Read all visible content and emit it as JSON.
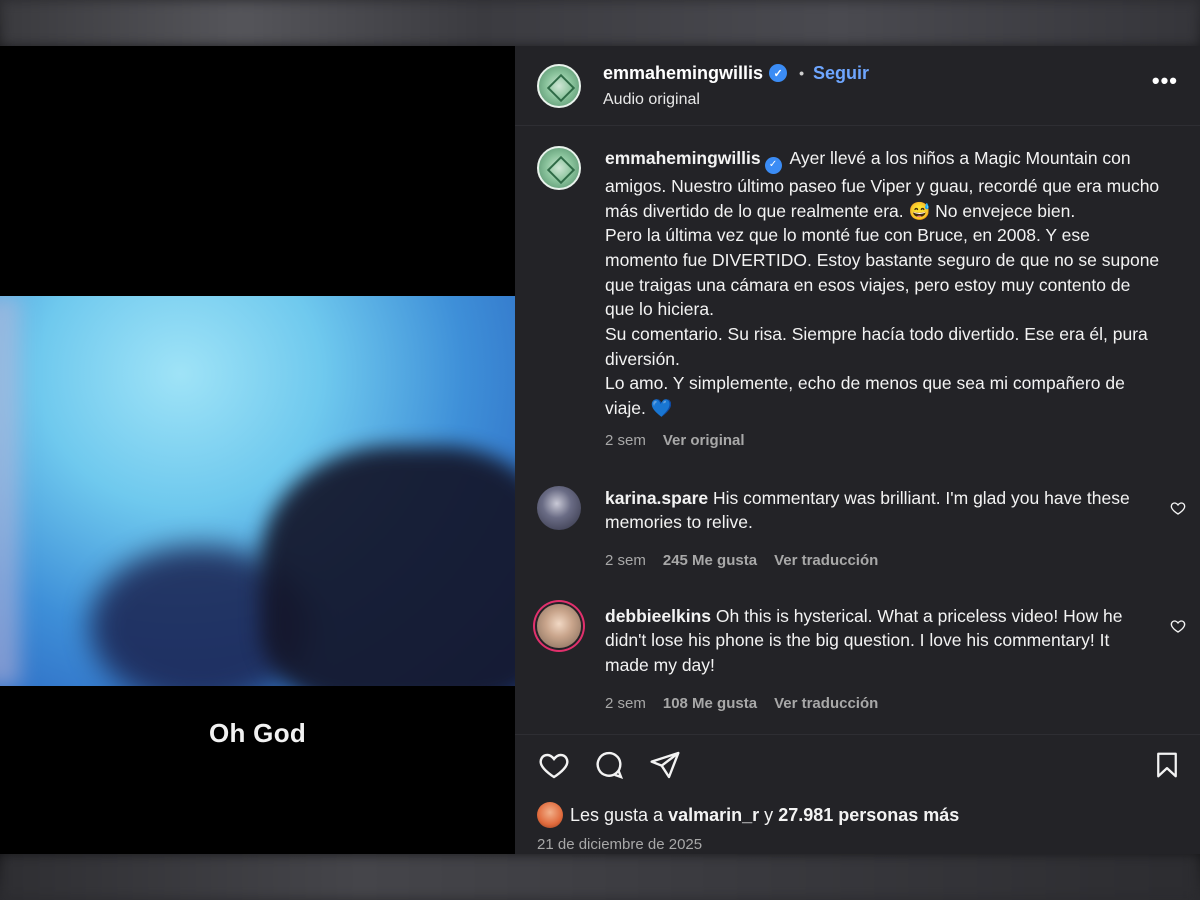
{
  "header": {
    "username": "emmahemingwillis",
    "follow_label": "Seguir",
    "dot": "•",
    "subtitle": "Audio original",
    "more_label": "•••"
  },
  "video": {
    "caption": "Oh God"
  },
  "caption_post": {
    "username": "emmahemingwillis",
    "text": "Ayer llevé a los niños a Magic Mountain con amigos. Nuestro último paseo fue Viper y guau, recordé que era mucho más divertido de lo que realmente era. 😅 No envejece bien.",
    "text2": "Pero la última vez que lo monté fue con Bruce, en 2008. Y ese momento fue DIVERTIDO. Estoy bastante seguro de que no se supone que traigas una cámara en esos viajes, pero estoy muy contento de que lo hiciera.",
    "text3": "Su comentario. Su risa. Siempre hacía todo divertido. Ese era él, pura diversión.",
    "text4": "Lo amo. Y simplemente, echo de menos que sea mi compañero de viaje. 💙",
    "time": "2 sem",
    "see_original": "Ver original"
  },
  "comments": [
    {
      "username": "karina.spare",
      "text": "His commentary was brilliant. I'm glad you have these memories to relive.",
      "time": "2 sem",
      "likes": "245 Me gusta",
      "translate": "Ver traducción"
    },
    {
      "username": "debbieelkins",
      "text": "Oh this is hysterical. What a priceless video! How he didn't lose his phone is the big question. I love his commentary! It made my day!",
      "time": "2 sem",
      "likes": "108 Me gusta",
      "translate": "Ver traducción"
    }
  ],
  "likes_line": {
    "prefix": "Les gusta a",
    "user": "valmarin_r",
    "conj": "y",
    "count": "27.981 personas más"
  },
  "date": "21 de diciembre de 2025",
  "colors": {
    "accent": "#6ea6ff",
    "verified": "#3b8cf5",
    "panel_bg": "#232327"
  }
}
